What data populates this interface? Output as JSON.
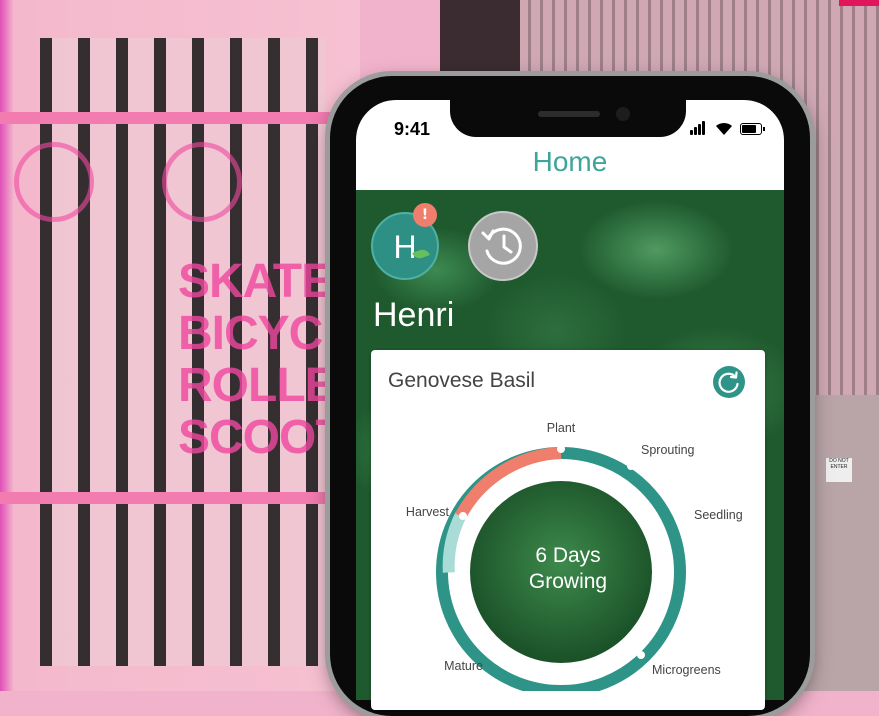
{
  "phone": {
    "status_time": "9:41",
    "nav_title": "Home"
  },
  "user": {
    "initial": "H",
    "alert": "!",
    "name": "Henri"
  },
  "card": {
    "title": "Genovese Basil",
    "center_line1": "6 Days",
    "center_line2": "Growing",
    "stages": [
      "Plant",
      "Sprouting",
      "Seedling",
      "Microgreens",
      "Mature",
      "Harvest"
    ]
  },
  "background": {
    "sign_lines": [
      "SKATEB",
      "BICYCL",
      "ROLLER",
      "SCOOTE"
    ],
    "building_sign": "DO NOT ENTER"
  },
  "colors": {
    "teal": "#2e9488",
    "title_teal": "#3fa59b",
    "progress_coral": "#ef7f6c",
    "harvest_light_teal": "#a9dcd6",
    "pink_bg": "#f1b3cb"
  },
  "icons": {
    "history": "history-clock-icon",
    "refresh": "refresh-icon",
    "avatar_leaf": "leaf-icon",
    "wifi": "wifi-icon",
    "battery": "battery-icon"
  }
}
